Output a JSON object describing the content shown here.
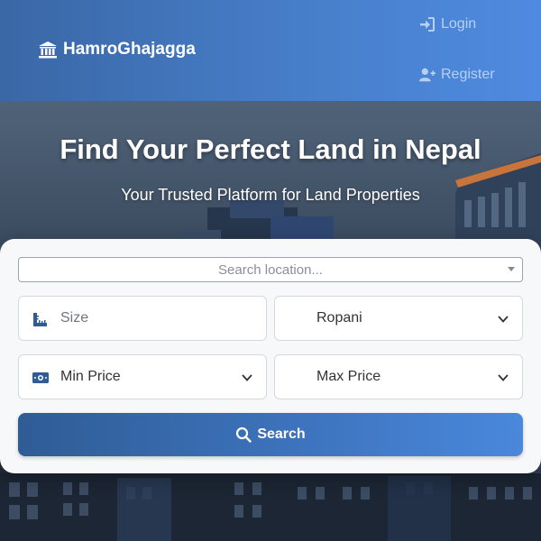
{
  "header": {
    "brand": "HamroGhajagga",
    "login_label": "Login",
    "register_label": "Register"
  },
  "hero": {
    "title": "Find Your Perfect Land in Nepal",
    "subtitle": "Your Trusted Platform for Land Properties"
  },
  "search": {
    "location_placeholder": "Search location...",
    "size_placeholder": "Size",
    "unit_value": "Ropani",
    "min_price_value": "Min Price",
    "max_price_value": "Max Price",
    "button_label": "Search"
  },
  "icons": {
    "brand": "landmark-icon",
    "login": "sign-in-icon",
    "register": "user-plus-icon",
    "size": "ruler-icon",
    "price": "money-bill-icon",
    "search": "search-icon",
    "dropdown": "chevron-down-icon"
  },
  "colors": {
    "header_start": "#3a67a6",
    "header_end": "#4f8ae0",
    "button_start": "#2f5c95",
    "button_end": "#4a88dc",
    "card_bg": "#f7f8fa"
  }
}
